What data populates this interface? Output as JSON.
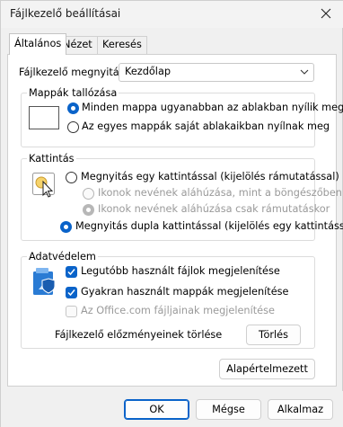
{
  "window": {
    "title": "Fájlkezelő beállításai"
  },
  "tabs": [
    {
      "label": "Általános",
      "active": true
    },
    {
      "label": "Nézet",
      "active": false
    },
    {
      "label": "Keresés",
      "active": false
    }
  ],
  "open_with": {
    "label": "Fájlkezelő megnyitása:",
    "value": "Kezdőlap"
  },
  "browse_folders": {
    "title": "Mappák tallózása",
    "options": [
      {
        "label": "Minden mappa ugyanabban az ablakban nyílik meg",
        "selected": true
      },
      {
        "label": "Az egyes mappák saját ablakaikban nyílnak meg",
        "selected": false
      }
    ]
  },
  "click_items": {
    "title": "Kattintás",
    "single_click": {
      "label": "Megnyitás egy kattintással (kijelölés rámutatással)",
      "selected": false
    },
    "underline_browser": {
      "label": "Ikonok nevének aláhúzása, mint a böngészőben",
      "selected": false,
      "disabled": true
    },
    "underline_hover": {
      "label": "Ikonok nevének aláhúzása csak rámutatáskor",
      "selected": true,
      "disabled": true
    },
    "double_click": {
      "label": "Megnyitás dupla kattintással (kijelölés egy kattintással)",
      "selected": true
    }
  },
  "privacy": {
    "title": "Adatvédelem",
    "recent_files": {
      "label": "Legutóbb használt fájlok megjelenítése",
      "checked": true
    },
    "frequent_folders": {
      "label": "Gyakran használt mappák megjelenítése",
      "checked": true
    },
    "office_files": {
      "label": "Az Office.com fájljainak megjelenítése",
      "checked": false,
      "disabled": true
    },
    "clear_history_label": "Fájlkezelő előzményeinek törlése",
    "clear_button": "Törlés"
  },
  "restore_defaults": "Alapértelmezett",
  "footer": {
    "ok": "OK",
    "cancel": "Mégse",
    "apply": "Alkalmaz"
  },
  "colors": {
    "accent": "#0a63c9",
    "panel_bg": "#ffffff",
    "window_bg": "#f0f0f0"
  }
}
